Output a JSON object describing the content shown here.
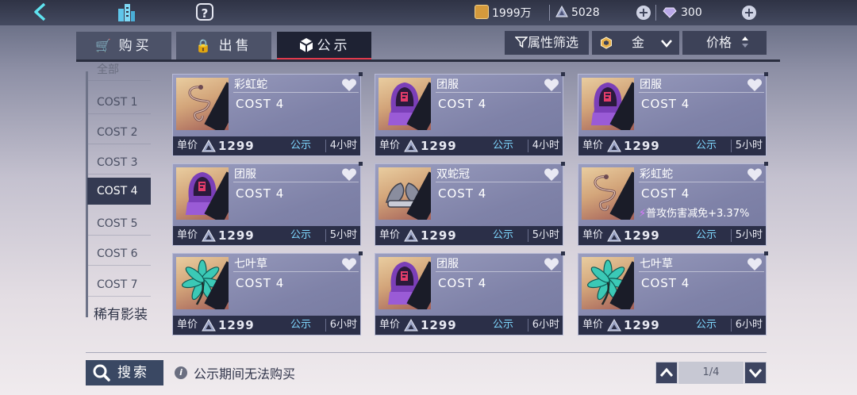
{
  "top": {
    "coins": "1999万",
    "gems": "5028",
    "diamonds": "300"
  },
  "tabs": [
    {
      "label": "购买"
    },
    {
      "label": "出售"
    },
    {
      "label": "公示"
    }
  ],
  "filters": {
    "attr": "属性筛选",
    "grade": "金",
    "price": "价格"
  },
  "sidebar": {
    "items": [
      {
        "label": "全部"
      },
      {
        "label": "COST 1"
      },
      {
        "label": "COST 2"
      },
      {
        "label": "COST 3"
      },
      {
        "label": "COST 4"
      },
      {
        "label": "COST 5"
      },
      {
        "label": "COST 6"
      },
      {
        "label": "COST 7"
      }
    ],
    "rare": "稀有影装"
  },
  "cards": [
    {
      "name": "彩虹蛇",
      "cost": "COST 4",
      "effect": "",
      "label": "单价",
      "price": "1299",
      "status": "公示",
      "time": "4小时",
      "icon": "snake-icon"
    },
    {
      "name": "团服",
      "cost": "COST 4",
      "effect": "",
      "label": "单价",
      "price": "1299",
      "status": "公示",
      "time": "4小时",
      "icon": "hood-icon"
    },
    {
      "name": "团服",
      "cost": "COST 4",
      "effect": "",
      "label": "单价",
      "price": "1299",
      "status": "公示",
      "time": "5小时",
      "icon": "hood-icon"
    },
    {
      "name": "团服",
      "cost": "COST 4",
      "effect": "",
      "label": "单价",
      "price": "1299",
      "status": "公示",
      "time": "5小时",
      "icon": "hood-icon"
    },
    {
      "name": "双蛇冠",
      "cost": "COST 4",
      "effect": "",
      "label": "单价",
      "price": "1299",
      "status": "公示",
      "time": "5小时",
      "icon": "crown-icon"
    },
    {
      "name": "彩虹蛇",
      "cost": "COST 4",
      "effect": "普攻伤害减免+3.37%",
      "label": "单价",
      "price": "1299",
      "status": "公示",
      "time": "5小时",
      "icon": "snake-icon"
    },
    {
      "name": "七叶草",
      "cost": "COST 4",
      "effect": "",
      "label": "单价",
      "price": "1299",
      "status": "公示",
      "time": "6小时",
      "icon": "leaf-icon"
    },
    {
      "name": "团服",
      "cost": "COST 4",
      "effect": "",
      "label": "单价",
      "price": "1299",
      "status": "公示",
      "time": "6小时",
      "icon": "hood-icon"
    },
    {
      "name": "七叶草",
      "cost": "COST 4",
      "effect": "",
      "label": "单价",
      "price": "1299",
      "status": "公示",
      "time": "6小时",
      "icon": "leaf-icon"
    }
  ],
  "footer": {
    "search": "搜索",
    "notice": "公示期间无法购买",
    "page": "1/4"
  },
  "colors": {
    "accent": "#e23a4c",
    "status": "#7fd8ff",
    "cardBar": "#2b2f48"
  }
}
